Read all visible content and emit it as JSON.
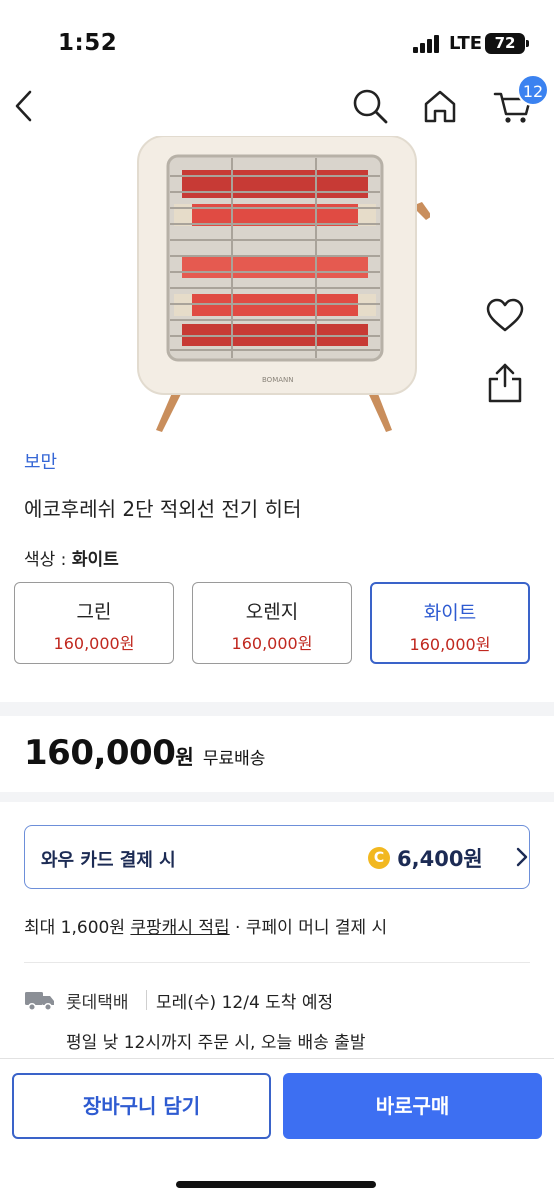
{
  "status": {
    "time": "1:52",
    "network": "LTE",
    "battery": "72"
  },
  "nav": {
    "cart_count": "12"
  },
  "product": {
    "brand": "보만",
    "title": "에코후레쉬 2단 적외선 전기 히터",
    "heater_logo": "BOMANN",
    "color_label": "색상 : ",
    "color_selected": "화이트",
    "options": [
      {
        "name": "그린",
        "price": "160,000원"
      },
      {
        "name": "오렌지",
        "price": "160,000원"
      },
      {
        "name": "화이트",
        "price": "160,000원"
      }
    ],
    "price": "160,000",
    "price_unit": "원",
    "shipping": "무료배송"
  },
  "wow_card": {
    "label": "와우 카드 결제 시",
    "coin": "C",
    "amount": "6,400원"
  },
  "cash": {
    "prefix": "최대 1,600원 ",
    "link": "쿠팡캐시 적립",
    "suffix": " · 쿠페이 머니 결제 시"
  },
  "delivery": {
    "carrier": "롯데택배",
    "eta": "모레(수) 12/4 도착 예정",
    "dispatch": "평일 낮 12시까지 주문 시, 오늘 배송 출발"
  },
  "actions": {
    "add_to_cart": "장바구니 담기",
    "buy_now": "바로구매"
  },
  "colors": {
    "accent": "#3d6ff2",
    "brand_link": "#3667d6",
    "price_red": "#c0281f",
    "badge": "#3b82f0"
  }
}
